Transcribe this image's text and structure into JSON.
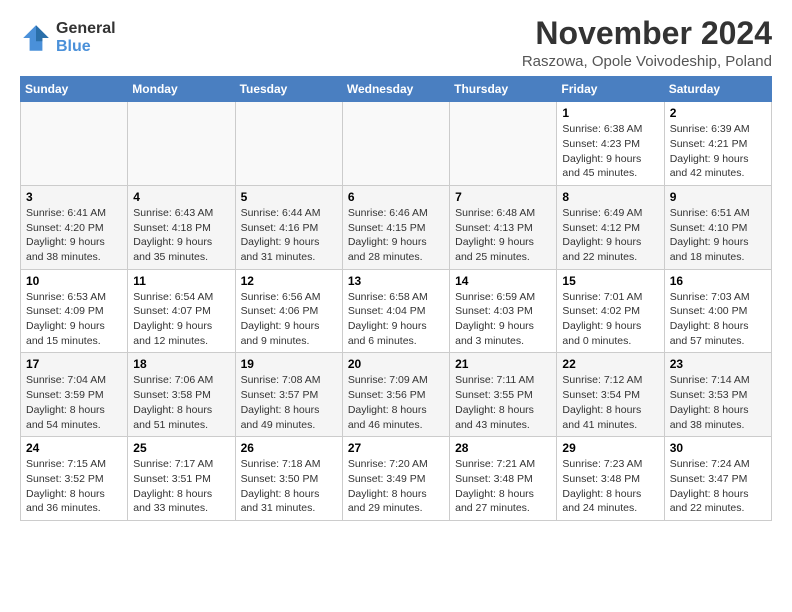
{
  "logo": {
    "general": "General",
    "blue": "Blue"
  },
  "title": "November 2024",
  "location": "Raszowa, Opole Voivodeship, Poland",
  "days_of_week": [
    "Sunday",
    "Monday",
    "Tuesday",
    "Wednesday",
    "Thursday",
    "Friday",
    "Saturday"
  ],
  "weeks": [
    [
      {
        "day": "",
        "info": ""
      },
      {
        "day": "",
        "info": ""
      },
      {
        "day": "",
        "info": ""
      },
      {
        "day": "",
        "info": ""
      },
      {
        "day": "",
        "info": ""
      },
      {
        "day": "1",
        "info": "Sunrise: 6:38 AM\nSunset: 4:23 PM\nDaylight: 9 hours and 45 minutes."
      },
      {
        "day": "2",
        "info": "Sunrise: 6:39 AM\nSunset: 4:21 PM\nDaylight: 9 hours and 42 minutes."
      }
    ],
    [
      {
        "day": "3",
        "info": "Sunrise: 6:41 AM\nSunset: 4:20 PM\nDaylight: 9 hours and 38 minutes."
      },
      {
        "day": "4",
        "info": "Sunrise: 6:43 AM\nSunset: 4:18 PM\nDaylight: 9 hours and 35 minutes."
      },
      {
        "day": "5",
        "info": "Sunrise: 6:44 AM\nSunset: 4:16 PM\nDaylight: 9 hours and 31 minutes."
      },
      {
        "day": "6",
        "info": "Sunrise: 6:46 AM\nSunset: 4:15 PM\nDaylight: 9 hours and 28 minutes."
      },
      {
        "day": "7",
        "info": "Sunrise: 6:48 AM\nSunset: 4:13 PM\nDaylight: 9 hours and 25 minutes."
      },
      {
        "day": "8",
        "info": "Sunrise: 6:49 AM\nSunset: 4:12 PM\nDaylight: 9 hours and 22 minutes."
      },
      {
        "day": "9",
        "info": "Sunrise: 6:51 AM\nSunset: 4:10 PM\nDaylight: 9 hours and 18 minutes."
      }
    ],
    [
      {
        "day": "10",
        "info": "Sunrise: 6:53 AM\nSunset: 4:09 PM\nDaylight: 9 hours and 15 minutes."
      },
      {
        "day": "11",
        "info": "Sunrise: 6:54 AM\nSunset: 4:07 PM\nDaylight: 9 hours and 12 minutes."
      },
      {
        "day": "12",
        "info": "Sunrise: 6:56 AM\nSunset: 4:06 PM\nDaylight: 9 hours and 9 minutes."
      },
      {
        "day": "13",
        "info": "Sunrise: 6:58 AM\nSunset: 4:04 PM\nDaylight: 9 hours and 6 minutes."
      },
      {
        "day": "14",
        "info": "Sunrise: 6:59 AM\nSunset: 4:03 PM\nDaylight: 9 hours and 3 minutes."
      },
      {
        "day": "15",
        "info": "Sunrise: 7:01 AM\nSunset: 4:02 PM\nDaylight: 9 hours and 0 minutes."
      },
      {
        "day": "16",
        "info": "Sunrise: 7:03 AM\nSunset: 4:00 PM\nDaylight: 8 hours and 57 minutes."
      }
    ],
    [
      {
        "day": "17",
        "info": "Sunrise: 7:04 AM\nSunset: 3:59 PM\nDaylight: 8 hours and 54 minutes."
      },
      {
        "day": "18",
        "info": "Sunrise: 7:06 AM\nSunset: 3:58 PM\nDaylight: 8 hours and 51 minutes."
      },
      {
        "day": "19",
        "info": "Sunrise: 7:08 AM\nSunset: 3:57 PM\nDaylight: 8 hours and 49 minutes."
      },
      {
        "day": "20",
        "info": "Sunrise: 7:09 AM\nSunset: 3:56 PM\nDaylight: 8 hours and 46 minutes."
      },
      {
        "day": "21",
        "info": "Sunrise: 7:11 AM\nSunset: 3:55 PM\nDaylight: 8 hours and 43 minutes."
      },
      {
        "day": "22",
        "info": "Sunrise: 7:12 AM\nSunset: 3:54 PM\nDaylight: 8 hours and 41 minutes."
      },
      {
        "day": "23",
        "info": "Sunrise: 7:14 AM\nSunset: 3:53 PM\nDaylight: 8 hours and 38 minutes."
      }
    ],
    [
      {
        "day": "24",
        "info": "Sunrise: 7:15 AM\nSunset: 3:52 PM\nDaylight: 8 hours and 36 minutes."
      },
      {
        "day": "25",
        "info": "Sunrise: 7:17 AM\nSunset: 3:51 PM\nDaylight: 8 hours and 33 minutes."
      },
      {
        "day": "26",
        "info": "Sunrise: 7:18 AM\nSunset: 3:50 PM\nDaylight: 8 hours and 31 minutes."
      },
      {
        "day": "27",
        "info": "Sunrise: 7:20 AM\nSunset: 3:49 PM\nDaylight: 8 hours and 29 minutes."
      },
      {
        "day": "28",
        "info": "Sunrise: 7:21 AM\nSunset: 3:48 PM\nDaylight: 8 hours and 27 minutes."
      },
      {
        "day": "29",
        "info": "Sunrise: 7:23 AM\nSunset: 3:48 PM\nDaylight: 8 hours and 24 minutes."
      },
      {
        "day": "30",
        "info": "Sunrise: 7:24 AM\nSunset: 3:47 PM\nDaylight: 8 hours and 22 minutes."
      }
    ]
  ]
}
